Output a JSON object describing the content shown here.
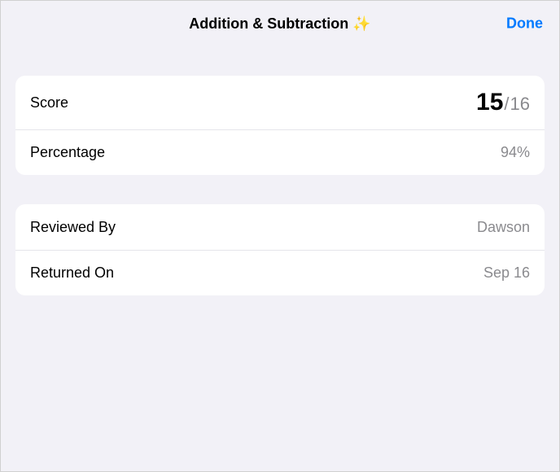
{
  "header": {
    "title": "Addition & Subtraction ✨",
    "done_label": "Done"
  },
  "score_section": {
    "score_label": "Score",
    "score_earned": "15",
    "score_separator": "/",
    "score_total": "16",
    "percentage_label": "Percentage",
    "percentage_value": "94%"
  },
  "review_section": {
    "reviewed_by_label": "Reviewed By",
    "reviewed_by_value": "Dawson",
    "returned_on_label": "Returned On",
    "returned_on_value": "Sep 16"
  }
}
